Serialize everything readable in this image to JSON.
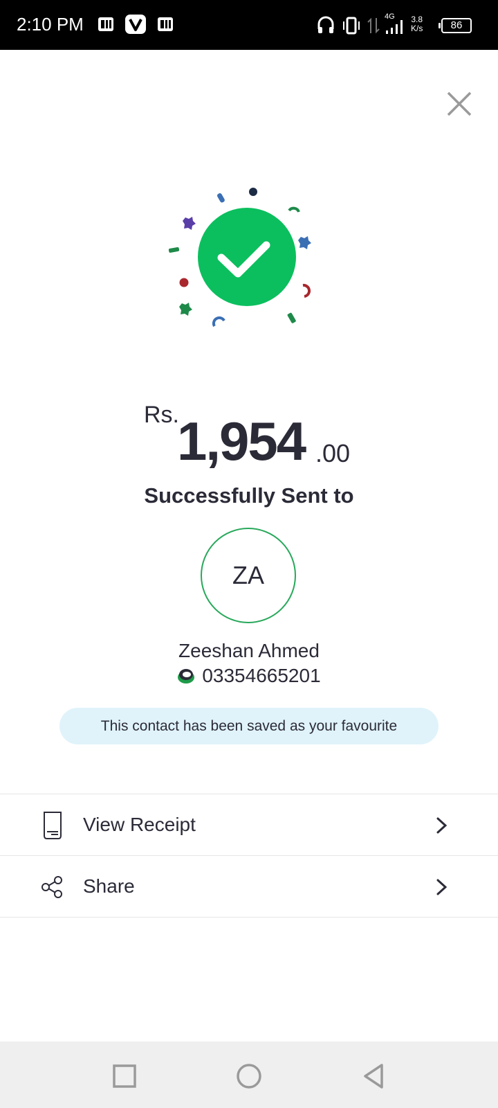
{
  "status_bar": {
    "time": "2:10 PM",
    "network": "4G",
    "speed_value": "3.8",
    "speed_unit": "K/s",
    "battery": "86"
  },
  "transaction": {
    "currency": "Rs.",
    "amount_integer": "1,954",
    "amount_decimal": ".00",
    "status_text": "Successfully Sent to"
  },
  "recipient": {
    "initials": "ZA",
    "name": "Zeeshan Ahmed",
    "phone": "03354665201"
  },
  "favourite_banner": "This contact has been saved as your favourite",
  "menu": [
    {
      "label": "View Receipt",
      "icon": "receipt-icon"
    },
    {
      "label": "Share",
      "icon": "share-icon"
    }
  ],
  "colors": {
    "success_green": "#0bbf5e",
    "avatar_border": "#27a85a",
    "banner_bg": "#e0f3fb",
    "text_dark": "#2b2b38"
  }
}
